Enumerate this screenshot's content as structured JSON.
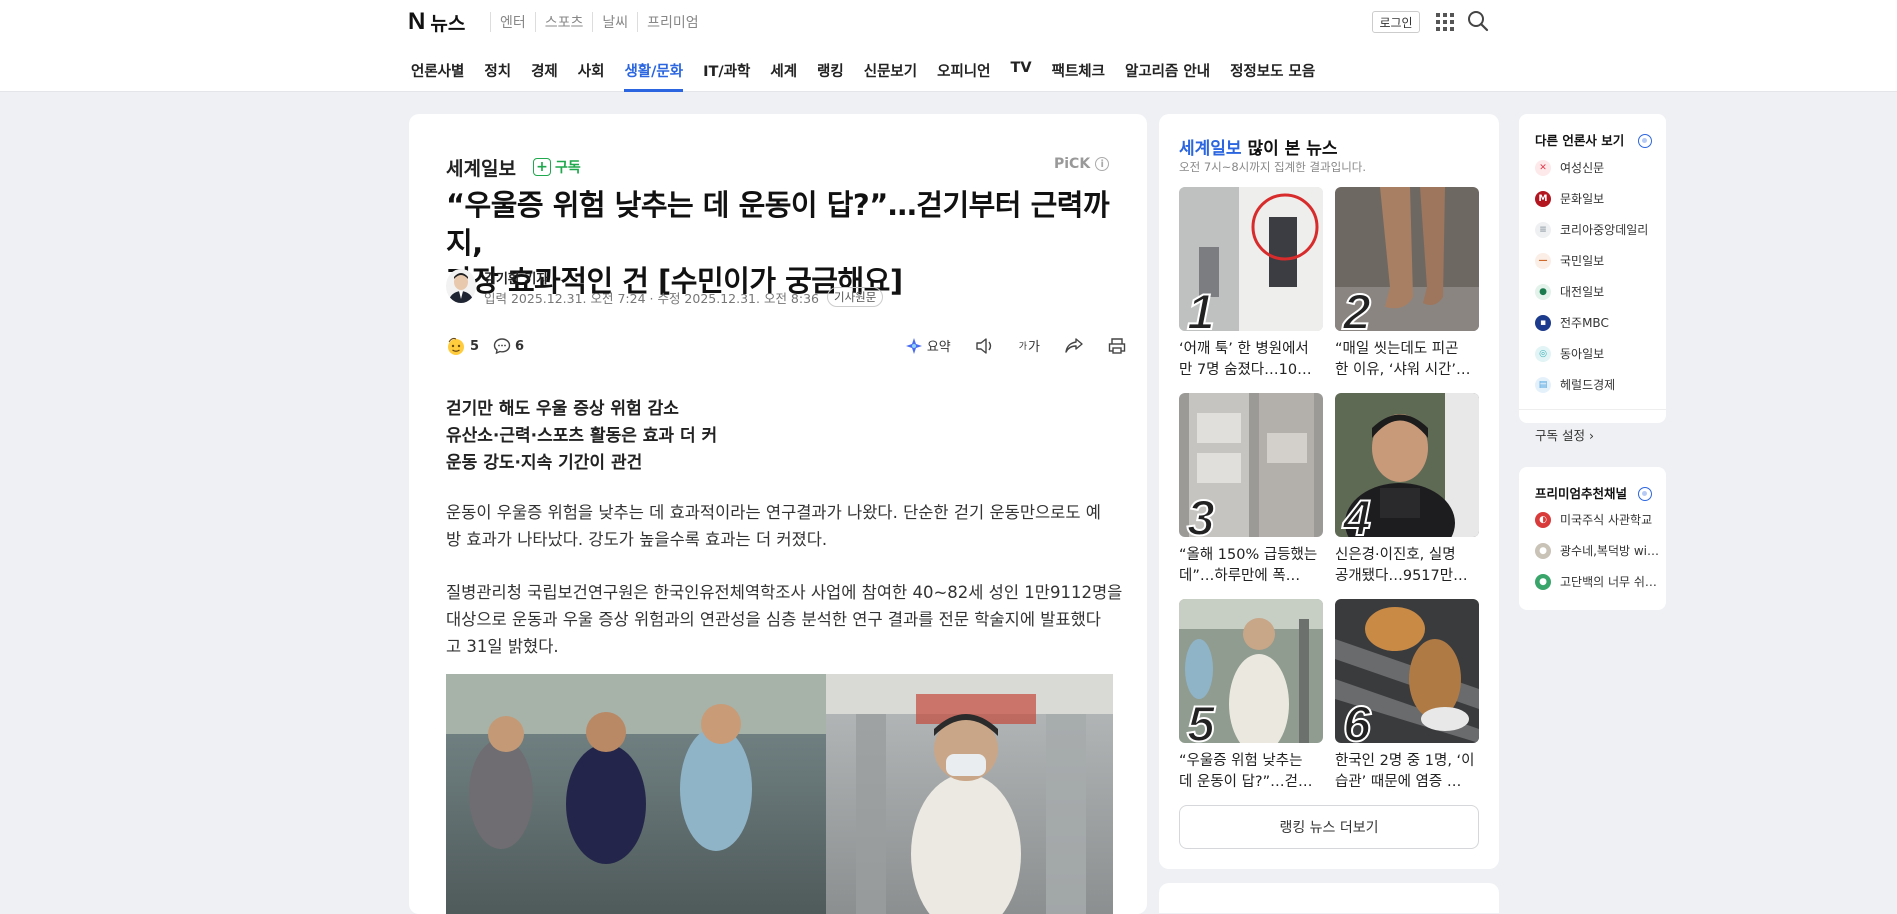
{
  "header": {
    "logo_n": "N",
    "logo_text": "뉴스",
    "services": [
      "엔터",
      "스포츠",
      "날씨",
      "프리미엄"
    ],
    "login": "로그인",
    "icons": [
      "apps-grid-icon",
      "search-icon"
    ]
  },
  "nav": {
    "tabs": [
      "언론사별",
      "정치",
      "경제",
      "사회",
      "생활/문화",
      "IT/과학",
      "세계",
      "랭킹",
      "신문보기",
      "오피니언",
      "TV",
      "팩트체크",
      "알고리즘 안내",
      "정정보도 모음"
    ],
    "active": "생활/문화"
  },
  "article": {
    "press": "세계일보",
    "subscribe": "구독",
    "pick": "PiCK",
    "headline_line1": "“우울증 위험 낮추는 데 운동이 답?”…걷기부터 근력까지,",
    "headline_line2": "가장 효과적인 건 [수민이가 궁금해요]",
    "reporter": "김기환 기자",
    "dates": "입력 2025.12.31. 오전 7:24 · 수정 2025.12.31. 오전 8:36",
    "original_btn": "기사원문",
    "reaction_count": "5",
    "comment_count": "6",
    "summary_label": "요약",
    "font_label": "가",
    "subheads": [
      "걷기만 해도 우울 증상 위험 감소",
      "유산소·근력·스포츠 활동은 효과 더 커",
      "운동 강도·지속 기간이 관건"
    ],
    "para1_line1": "운동이 우울증 위험을 낮추는 데 효과적이라는 연구결과가 나왔다. 단순한 걷기 운동만으로도 예",
    "para1_line2": "방 효과가 나타났다. 강도가 높을수록 효과는 더 커졌다.",
    "para2_line1": "질병관리청 국립보건연구원은 한국인유전체역학조사 사업에 참여한 40~82세 성인 1만9112명을",
    "para2_line2": "대상으로 운동과 우울 증상 위험과의 연관성을 심층 분석한 연구 결과를 전문 학술지에 발표했다",
    "para2_line3": "고 31일 밝혔다."
  },
  "ranking": {
    "press": "세계일보",
    "title_rest": " 많이 본 뉴스",
    "subtitle": "오전 7시~8시까지 집계한 결과입니다.",
    "items": [
      {
        "num": "1",
        "line1": "‘어깨 툭’ 한 병원에서",
        "line2": "만 7명 숨졌다…10…"
      },
      {
        "num": "2",
        "line1": "“매일 씻는데도 피곤",
        "line2": "한 이유, ‘샤워 시간’…"
      },
      {
        "num": "3",
        "line1": "“올해 150% 급등했는",
        "line2": "데”…하루만에 폭…"
      },
      {
        "num": "4",
        "line1": "신은경·이진호, 실명",
        "line2": "공개됐다…9517만…"
      },
      {
        "num": "5",
        "line1": "“우울증 위험 낮추는",
        "line2": "데 운동이 답?”…걷…"
      },
      {
        "num": "6",
        "line1": "한국인 2명 중 1명, ‘이",
        "line2": "습관’ 때문에 염증 …"
      }
    ],
    "more": "랭킹 뉴스 더보기"
  },
  "other_press": {
    "title": "다른 언론사 보기",
    "items": [
      {
        "name": "여성신문",
        "color": "#e0394a"
      },
      {
        "name": "문화일보",
        "color": "#b3161f"
      },
      {
        "name": "코리아중앙데일리",
        "color": "#9aa3ad"
      },
      {
        "name": "국민일보",
        "color": "#d06a2c"
      },
      {
        "name": "대전일보",
        "color": "#1a7b4f"
      },
      {
        "name": "전주MBC",
        "color": "#1d3b8c"
      },
      {
        "name": "동아일보",
        "color": "#3ab0b8"
      },
      {
        "name": "헤럴드경제",
        "color": "#4aa3df"
      }
    ],
    "settings": "구독 설정 ›"
  },
  "premium": {
    "title": "프리미엄추천채널",
    "items": [
      {
        "name": "미국주식 사관학교",
        "color": "#d93a3a"
      },
      {
        "name": "광수네,복덕방 wi…",
        "color": "#c9c2b6"
      },
      {
        "name": "고단백의 너무 쉬…",
        "color": "#3aa56a"
      }
    ]
  }
}
